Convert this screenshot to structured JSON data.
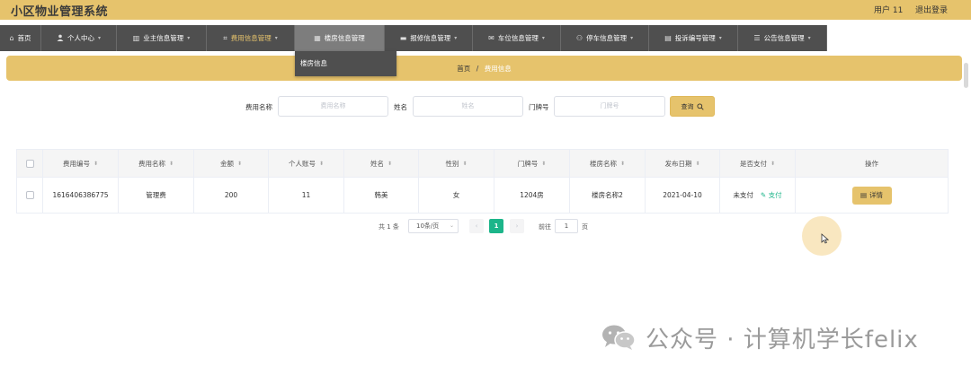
{
  "app": {
    "title": "小区物业管理系统",
    "user_label": "用户 11",
    "logout_label": "退出登录"
  },
  "nav": {
    "items": [
      {
        "label": "首页",
        "icon": "home-icon",
        "glyph": "⌂"
      },
      {
        "label": "个人中心",
        "icon": "user-icon",
        "glyph": "👤"
      },
      {
        "label": "业主信息管理",
        "icon": "chart-icon",
        "glyph": "▥"
      },
      {
        "label": "费用信息管理",
        "icon": "crop-icon",
        "glyph": "⌗"
      },
      {
        "label": "楼房信息管理",
        "icon": "building-icon",
        "glyph": "▦"
      },
      {
        "label": "报修信息管理",
        "icon": "monitor-icon",
        "glyph": "▬"
      },
      {
        "label": "车位信息管理",
        "icon": "mail-icon",
        "glyph": "✉"
      },
      {
        "label": "停车信息管理",
        "icon": "people-icon",
        "glyph": "⚇"
      },
      {
        "label": "投诉编号管理",
        "icon": "briefcase-icon",
        "glyph": "▤"
      },
      {
        "label": "公告信息管理",
        "icon": "list-icon",
        "glyph": "☰"
      }
    ],
    "dropdown": {
      "item": "楼房信息"
    }
  },
  "breadcrumb": {
    "home": "首页",
    "separator": "/",
    "current": "费用信息"
  },
  "search": {
    "fields": [
      {
        "label": "费用名称",
        "placeholder": "费用名称"
      },
      {
        "label": "姓名",
        "placeholder": "姓名"
      },
      {
        "label": "门牌号",
        "placeholder": "门牌号"
      }
    ],
    "button_label": "查询"
  },
  "table": {
    "headers": [
      "费用编号",
      "费用名称",
      "金额",
      "个人账号",
      "姓名",
      "性别",
      "门牌号",
      "楼房名称",
      "发布日期",
      "是否支付",
      "操作"
    ],
    "rows": [
      {
        "id": "1616406386775",
        "fee_name": "管理费",
        "amount": "200",
        "account": "11",
        "name": "韩美",
        "gender": "女",
        "door": "1204房",
        "building": "楼房名称2",
        "date": "2021-04-10",
        "paid_status": "未支付",
        "pay_action": "支付",
        "detail_label": "详情"
      }
    ]
  },
  "pagination": {
    "total": "共 1 条",
    "page_size": "10条/页",
    "current_page": "1",
    "goto_label": "前往",
    "jump_value": "1",
    "page_unit": "页"
  },
  "watermark": {
    "text": "公众号 · 计算机学长felix"
  },
  "colors": {
    "accent": "#e6c36c",
    "nav": "#4f4f4f",
    "success": "#1cb58a"
  }
}
